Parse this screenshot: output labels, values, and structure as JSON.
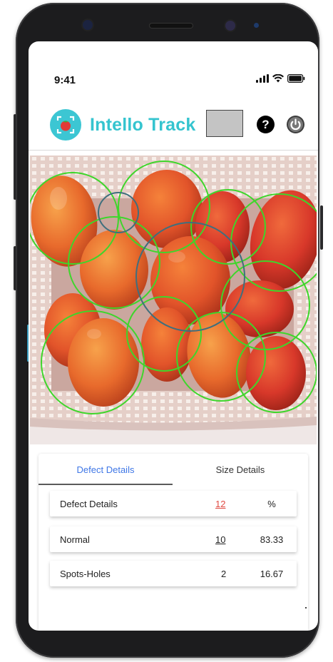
{
  "status_bar": {
    "time": "9:41"
  },
  "app": {
    "title": "Intello Track",
    "logo_icon": "tomato-camera-icon",
    "accent_color": "#35c4cf",
    "swatch_color": "#c4c4c4"
  },
  "toolbar": {
    "help_label": "?"
  },
  "image": {
    "subject": "tomatoes-in-basket",
    "detection_circle_colors": {
      "normal": "#3ed62b",
      "defect": "#3f6f7d"
    }
  },
  "tabs": [
    {
      "label": "Defect Details",
      "active": true
    },
    {
      "label": "Size Details",
      "active": false
    }
  ],
  "table": {
    "header": {
      "label": "Defect Details",
      "count": "12",
      "percent": "%"
    },
    "rows": [
      {
        "label": "Normal",
        "count": "10",
        "percent": "83.33"
      },
      {
        "label": "Spots-Holes",
        "count": "2",
        "percent": "16.67"
      }
    ]
  }
}
